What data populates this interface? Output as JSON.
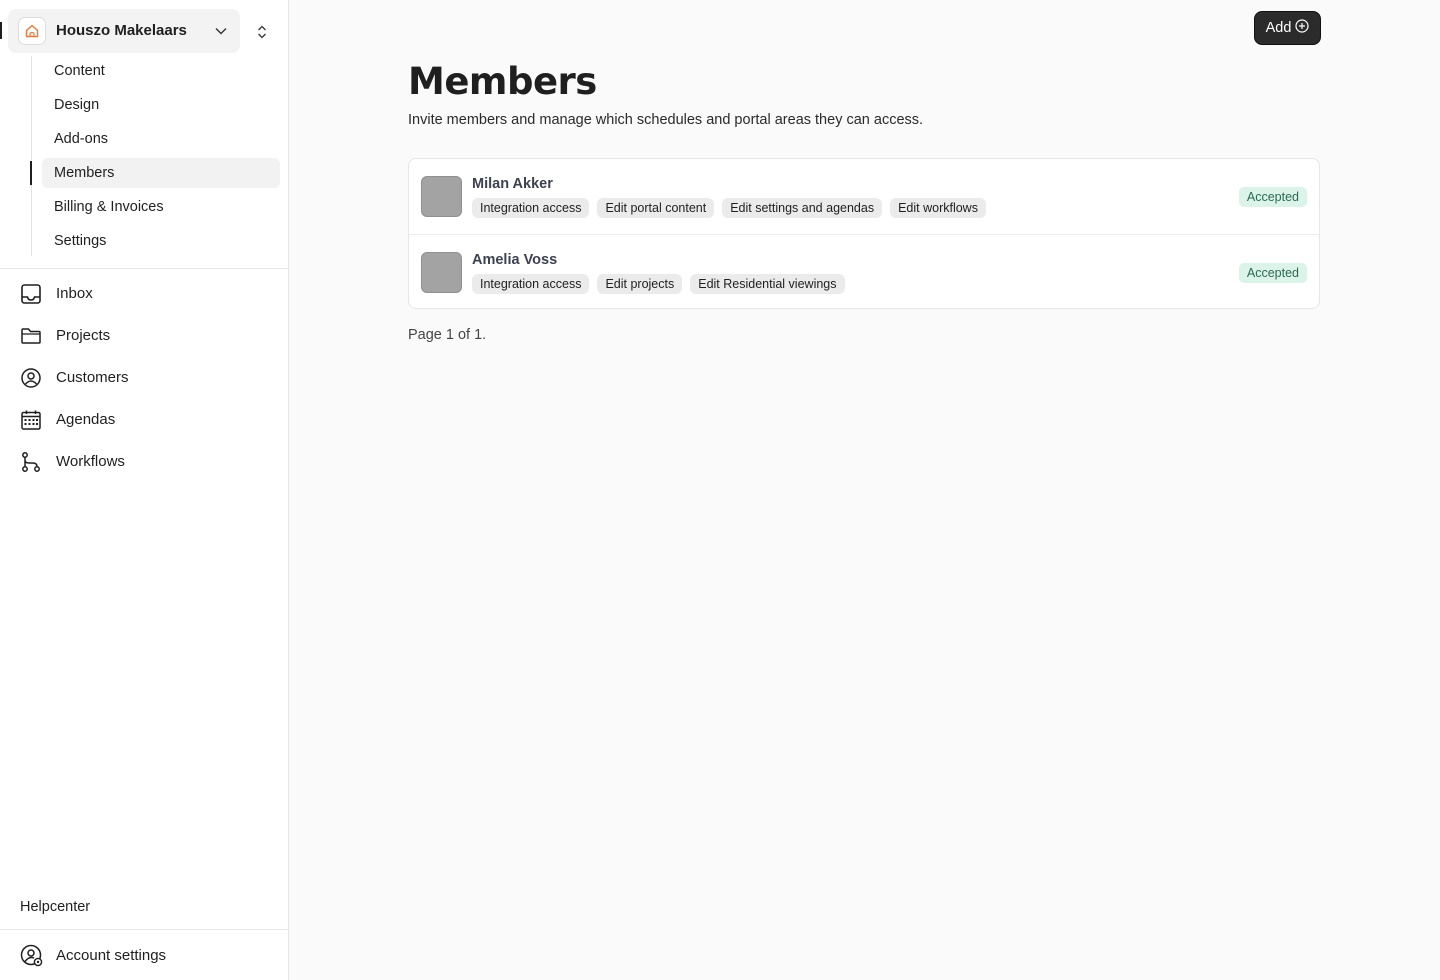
{
  "sidebar": {
    "org_name": "Houszo Makelaars",
    "sub_items": [
      {
        "label": "Content"
      },
      {
        "label": "Design"
      },
      {
        "label": "Add-ons"
      },
      {
        "label": "Members",
        "active": true
      },
      {
        "label": "Billing & Invoices"
      },
      {
        "label": "Settings"
      }
    ],
    "nav_items": [
      {
        "label": "Inbox",
        "icon": "inbox-icon"
      },
      {
        "label": "Projects",
        "icon": "folder-icon"
      },
      {
        "label": "Customers",
        "icon": "user-circle-icon"
      },
      {
        "label": "Agendas",
        "icon": "calendar-icon"
      },
      {
        "label": "Workflows",
        "icon": "workflow-icon"
      }
    ],
    "helpcenter": "Helpcenter",
    "account_settings": "Account settings"
  },
  "header": {
    "add_label": "Add"
  },
  "main": {
    "title": "Members",
    "description": "Invite members and manage which schedules and portal areas they can access.",
    "members": [
      {
        "name": "Milan Akker",
        "tags": [
          "Integration access",
          "Edit portal content",
          "Edit settings and agendas",
          "Edit workflows"
        ],
        "status": "Accepted"
      },
      {
        "name": "Amelia Voss",
        "tags": [
          "Integration access",
          "Edit projects",
          "Edit Residential viewings"
        ],
        "status": "Accepted"
      }
    ],
    "pagination": "Page 1 of 1."
  },
  "colors": {
    "accent_brand": "#e8793a",
    "status_bg": "#dcf3ea",
    "status_text": "#2c6b52",
    "primary_button": "#2b2b2b"
  }
}
